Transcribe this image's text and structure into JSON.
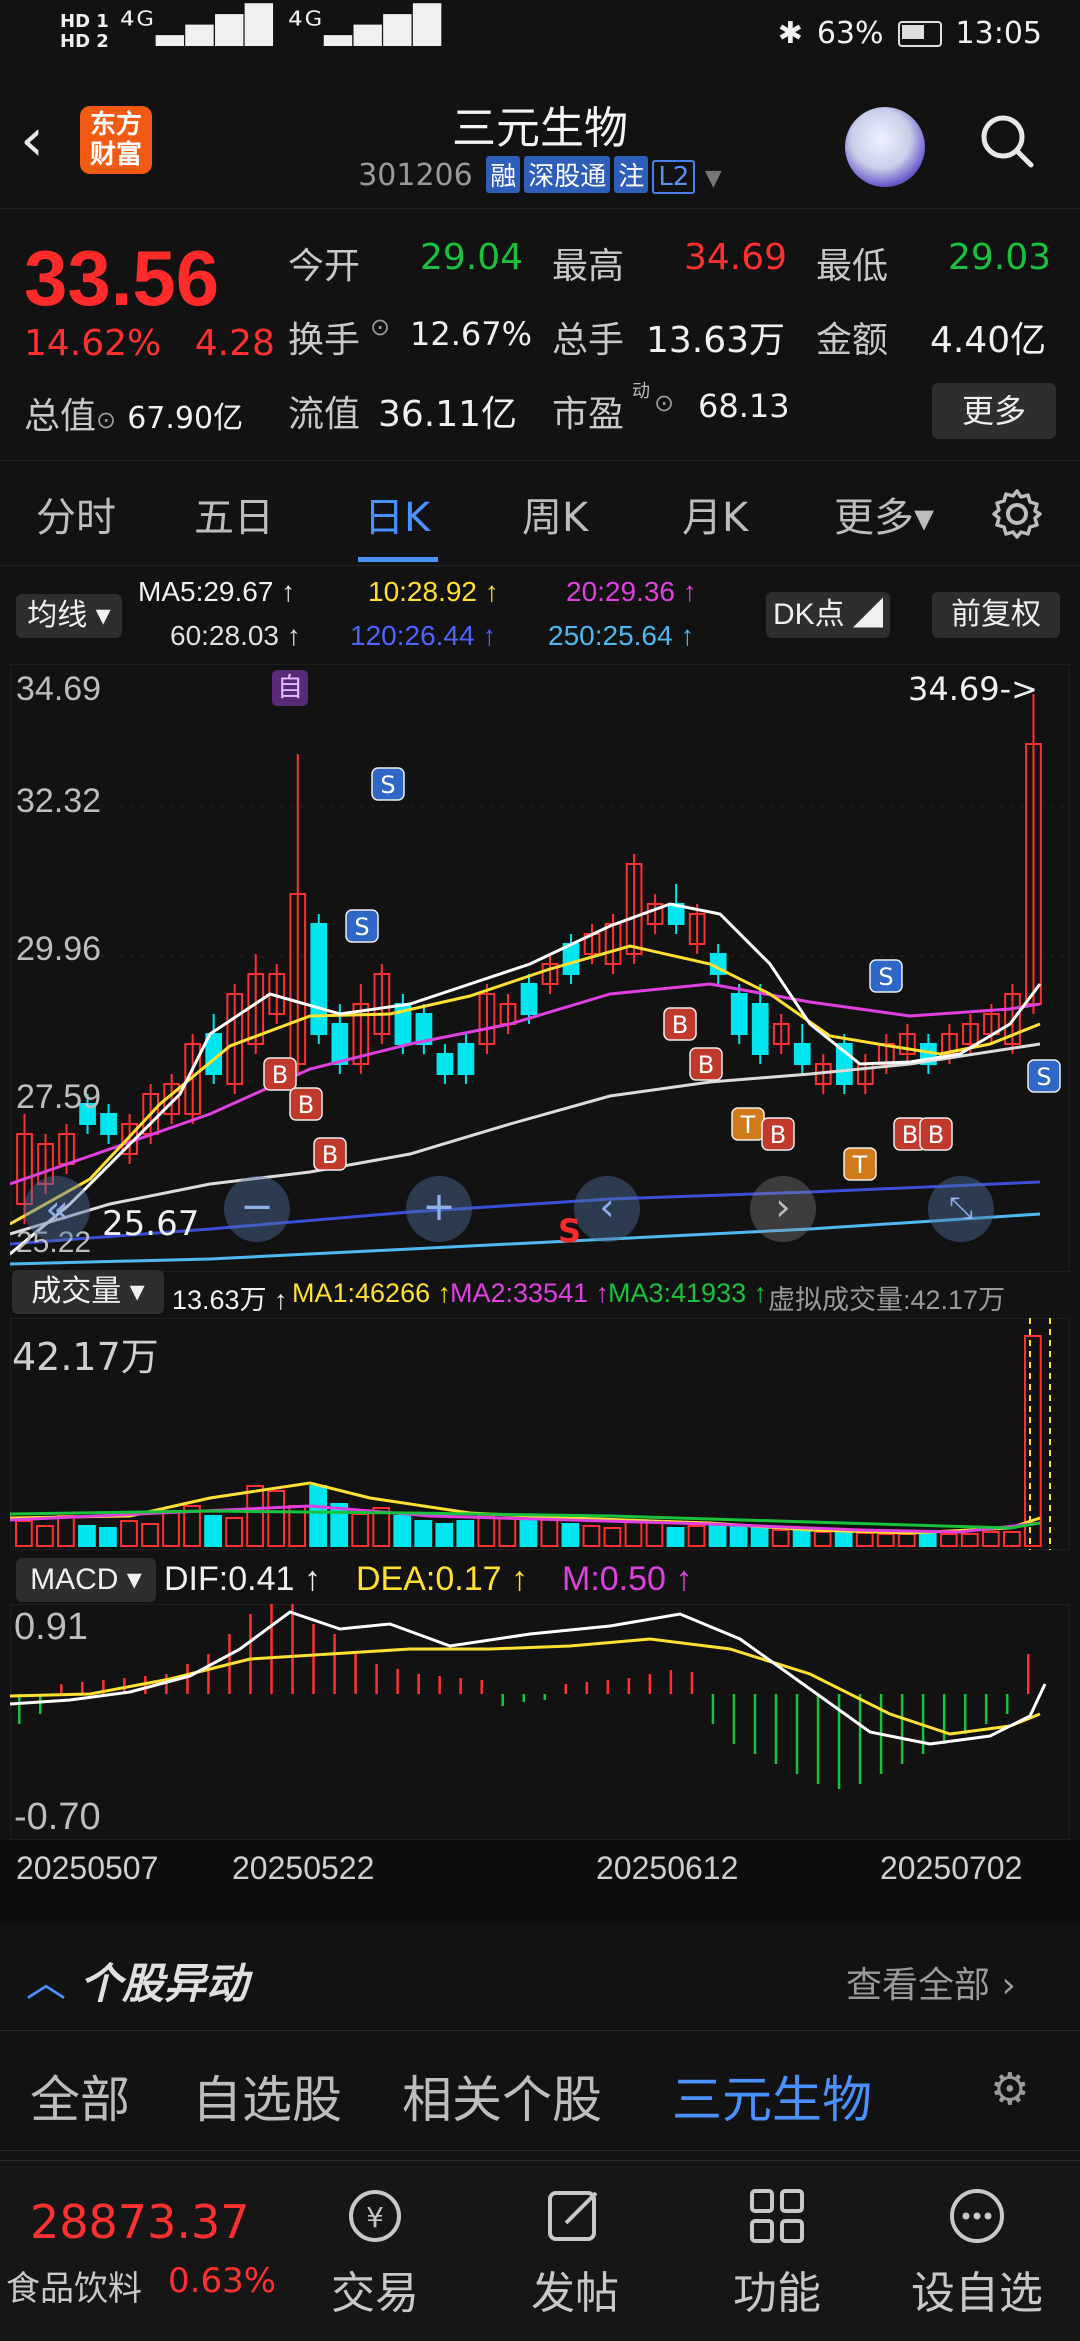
{
  "status_bar": {
    "network_left": "HD 1\nHD 2",
    "signal_text": "⁴ᴳ▂▄▆█ ⁴ᴳ▂▄▆█",
    "battery": "63%",
    "time": "13:05"
  },
  "header": {
    "logo_text": "东方\n财富",
    "title": "三元生物",
    "code": "301206",
    "tags": [
      "融",
      "深股通",
      "注",
      "L2"
    ]
  },
  "quote": {
    "price": "33.56",
    "change_pct": "14.62%",
    "change_abs": "4.28",
    "open_label": "今开",
    "open_value": "29.04",
    "high_label": "最高",
    "high_value": "34.69",
    "low_label": "最低",
    "low_value": "29.03",
    "turnover_label": "换手",
    "turnover_value": "12.67%",
    "volume_label": "总手",
    "volume_value": "13.63万",
    "amount_label": "金额",
    "amount_value": "4.40亿",
    "mktcap_label": "总值",
    "mktcap_value": "67.90亿",
    "float_label": "流值",
    "float_value": "36.11亿",
    "pe_label": "市盈",
    "pe_sup": "动",
    "pe_value": "68.13",
    "more_button": "更多"
  },
  "tabs": [
    "分时",
    "五日",
    "日K",
    "周K",
    "月K",
    "更多▾"
  ],
  "ma_row": {
    "selector": "均线 ▾",
    "ma5": "MA5:29.67 ↑",
    "ma10": "10:28.92 ↑",
    "ma20": "20:29.36 ↑",
    "ma60": "60:28.03 ↑",
    "ma120": "120:26.44 ↑",
    "ma250": "250:25.64 ↑",
    "dk_button": "DK点 ◢",
    "adjust_button": "前复权"
  },
  "chart": {
    "y_ticks": [
      "34.69",
      "32.32",
      "29.96",
      "27.59",
      "25.22"
    ],
    "high_marker": "34.69->",
    "low_marker": "25.67",
    "self_marker": "自",
    "s_center": "S"
  },
  "volume_row": {
    "selector": "成交量 ▾",
    "vol": "13.63万 ↑",
    "ma1": "MA1:46266 ↑",
    "ma2": "MA2:33541 ↑",
    "ma3": "MA3:41933 ↑",
    "virtual": "虚拟成交量:42.17万",
    "max_label": "42.17万"
  },
  "macd_row": {
    "selector": "MACD ▾",
    "dif": "DIF:0.41 ↑",
    "dea": "DEA:0.17 ↑",
    "m": "M:0.50 ↑",
    "top": "0.91",
    "bottom": "-0.70"
  },
  "dates": [
    "20250507",
    "20250522",
    "20250612",
    "20250702"
  ],
  "movers": {
    "title": "个股异动",
    "view_all": "查看全部 ›"
  },
  "subtabs": [
    "全部",
    "自选股",
    "相关个股",
    "三元生物"
  ],
  "navbar": {
    "index_value": "28873.37",
    "index_name": "食品饮料",
    "index_change": "0.63%",
    "items": [
      "交易",
      "发帖",
      "功能",
      "设自选"
    ]
  },
  "colors": {
    "up": "#ff3030",
    "down": "#00e5ee",
    "accent": "#4a90ff",
    "ma5": "#ffffff",
    "ma10": "#ffe033",
    "ma20": "#e040e0",
    "ma60": "#e0e0e0",
    "ma120": "#3a4fd8",
    "ma250": "#4fb8f0"
  },
  "chart_data": {
    "type": "candlestick",
    "x": [
      "20250507",
      "20250522",
      "20250612",
      "20250702"
    ],
    "ylim": [
      25.22,
      34.69
    ],
    "last_close": 33.56,
    "last_high": 34.69,
    "last_low": 29.03,
    "last_open": 29.04,
    "volume_max": 421700,
    "macd": {
      "dif": 0.41,
      "dea": 0.17,
      "m": 0.5,
      "ylim": [
        -0.7,
        0.91
      ]
    }
  }
}
